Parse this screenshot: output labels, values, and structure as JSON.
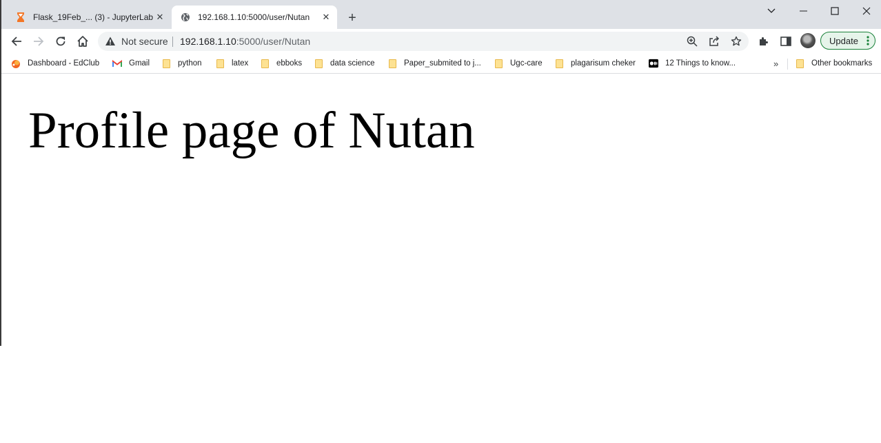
{
  "tabs": [
    {
      "title": "Flask_19Feb_... (3) - JupyterLab",
      "favicon": "hourglass-icon",
      "active": false
    },
    {
      "title": "192.168.1.10:5000/user/Nutan",
      "favicon": "globe-icon",
      "active": true
    }
  ],
  "toolbar": {
    "security_label": "Not secure",
    "url_host": "192.168.1.10",
    "url_rest": ":5000/user/Nutan",
    "update_label": "Update"
  },
  "bookmarks": [
    {
      "label": "Dashboard - EdClub",
      "icon": "edclub-icon"
    },
    {
      "label": "Gmail",
      "icon": "gmail-icon"
    },
    {
      "label": "python",
      "icon": "folder-icon"
    },
    {
      "label": "latex",
      "icon": "folder-icon"
    },
    {
      "label": "ebboks",
      "icon": "folder-icon"
    },
    {
      "label": "data science",
      "icon": "folder-icon"
    },
    {
      "label": "Paper_submited to j...",
      "icon": "folder-icon"
    },
    {
      "label": "Ugc-care",
      "icon": "folder-icon"
    },
    {
      "label": "plagarisum cheker",
      "icon": "folder-icon"
    },
    {
      "label": "12 Things to know...",
      "icon": "medium-icon"
    }
  ],
  "bookmarks_overflow": "»",
  "other_bookmarks": "Other bookmarks",
  "page": {
    "heading": "Profile page of Nutan"
  },
  "colors": {
    "tabstrip": "#dee1e6",
    "omnibox": "#f1f3f4",
    "update_border": "#188038",
    "update_bg": "#e6f4ea",
    "folder": "#fde293"
  }
}
